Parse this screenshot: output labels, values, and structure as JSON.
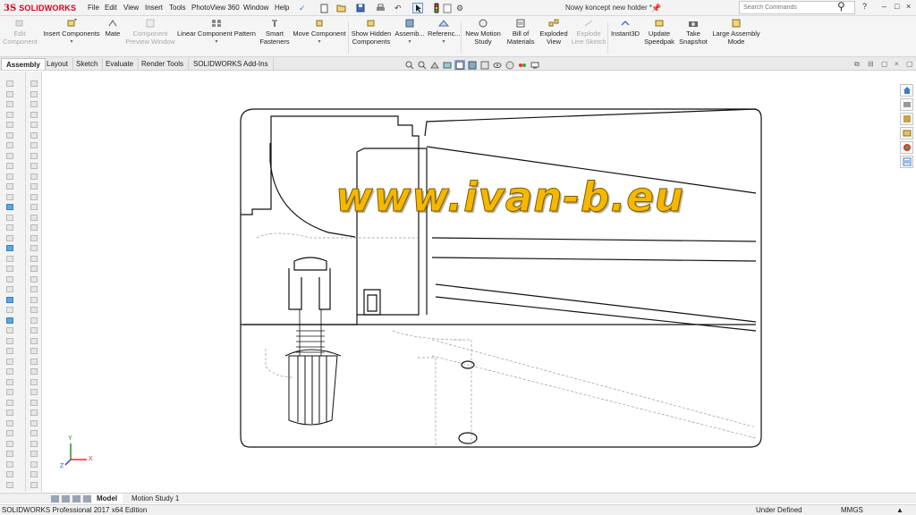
{
  "app": {
    "logo_ds": "3S",
    "logo_name": "SOLIDWORKS",
    "document_title": "Nowy koncept new holder *",
    "search_placeholder": "Search Commands"
  },
  "menu": [
    "File",
    "Edit",
    "View",
    "Insert",
    "Tools",
    "PhotoView 360",
    "Window",
    "Help"
  ],
  "ribbon": {
    "edit_component": "Edit Component",
    "insert_components": "Insert Components",
    "mate": "Mate",
    "component_preview": "Component Preview Window",
    "linear_pattern": "Linear Component Pattern",
    "smart_fasteners": "Smart Fasteners",
    "move_component": "Move Component",
    "show_hidden": "Show Hidden Components",
    "assembly": "Assemb...",
    "reference": "Referenc...",
    "new_motion": "New Motion Study",
    "bom": "Bill of Materials",
    "exploded_view": "Exploded View",
    "explode_sketch": "Explode Line Sketch",
    "instant3d": "Instant3D",
    "update_speedpak": "Update Speedpak",
    "take_snapshot": "Take Snapshot",
    "large_assembly": "Large Assembly Mode"
  },
  "tabs": [
    "Assembly",
    "Layout",
    "Sketch",
    "Evaluate",
    "Render Tools",
    "SOLIDWORKS Add-Ins"
  ],
  "watermark": "www.ivan-b.eu",
  "bottom_tabs": [
    "Model",
    "Motion Study 1"
  ],
  "status": {
    "edition": "SOLIDWORKS Professional 2017 x64 Edition",
    "state": "Under Defined",
    "units": "MMGS"
  },
  "triad": {
    "y": "Y",
    "x": "X",
    "z": "Z"
  },
  "colors": {
    "brand": "#d6001c",
    "watermark_fill": "#f5b800",
    "accent": "#5ea6e3"
  },
  "icons": [
    "save-icon",
    "print-icon",
    "undo-icon",
    "select-icon",
    "rebuild-icon",
    "options-icon",
    "search-icon",
    "help-icon"
  ]
}
